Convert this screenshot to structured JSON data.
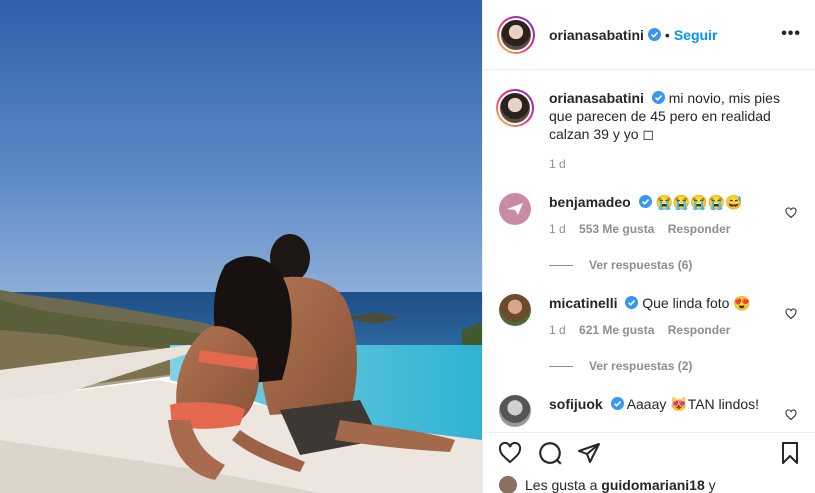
{
  "post": {
    "author": "orianasabatini",
    "follow_label": "Seguir",
    "separator": "•",
    "more_label": "•••"
  },
  "caption": {
    "user": "orianasabatini",
    "text": "mi novio, mis pies que parecen de 45 pero en realidad calzan 39 y yo ◻",
    "time": "1 d"
  },
  "comments": [
    {
      "user": "benjamadeo",
      "text": "😭😭😭😭😅",
      "time": "1 d",
      "likes": "553 Me gusta",
      "reply_label": "Responder",
      "view_replies": "Ver respuestas (6)"
    },
    {
      "user": "micatinelli",
      "text": "Que linda foto 😍",
      "time": "1 d",
      "likes": "621 Me gusta",
      "reply_label": "Responder",
      "view_replies": "Ver respuestas (2)"
    },
    {
      "user": "sofijuok",
      "text": "Aaaay 😻TAN lindos!"
    }
  ],
  "likes_line": {
    "prefix": "Les gusta a",
    "user": "guidomariani18",
    "suffix": "y"
  },
  "icons": [
    "heart-icon",
    "comment-icon",
    "share-icon",
    "bookmark-icon",
    "verified-icon",
    "more-icon"
  ],
  "colors": {
    "accent": "#0095f6",
    "verified": "#3897f0",
    "muted": "#8e8e8e"
  }
}
